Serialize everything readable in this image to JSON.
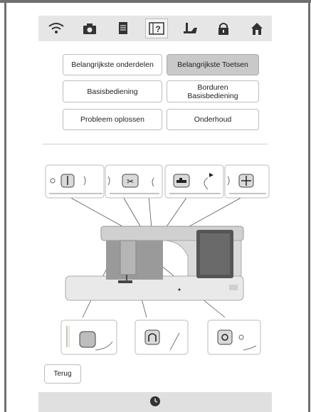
{
  "topbar": {
    "icons": [
      "wifi-icon",
      "camera-icon",
      "document-icon",
      "help-icon",
      "presser-foot-icon",
      "lock-icon",
      "home-icon"
    ],
    "active": "help-icon"
  },
  "menu": {
    "main_parts": "Belangrijkste onderdelen",
    "main_buttons": "Belangrijkste Toetsen",
    "basic_operation": "Basisbediening",
    "embroidery_line1": "Borduren",
    "embroidery_line2": "Basisbediening",
    "troubleshooting": "Probleem oplossen",
    "maintenance": "Onderhoud"
  },
  "footer": {
    "back_label": "Terug"
  },
  "colors": {
    "selected_button": "#c9c9c9",
    "frame": "#6f6f6f",
    "bar": "#e0e0e0"
  }
}
